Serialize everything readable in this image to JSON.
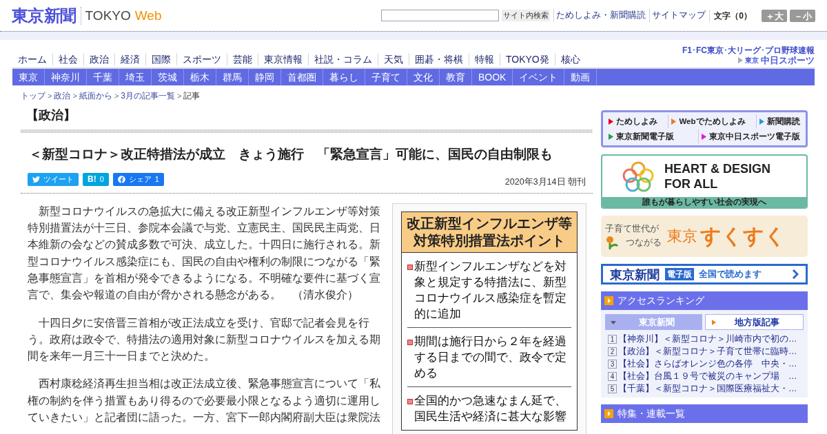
{
  "header": {
    "logo": "東京新聞",
    "brand_main": "TOKYO",
    "brand_accent": "Web",
    "search_button": "サイト内検索",
    "links": [
      "ためしよみ・新聞購読",
      "サイトマップ"
    ],
    "font_size_label": "文字（0）",
    "font_buttons": [
      "＋大",
      "－小"
    ]
  },
  "nav": {
    "items": [
      "ホーム",
      "社会",
      "政治",
      "経済",
      "国際",
      "スポーツ",
      "芸能",
      "東京情報",
      "社説・コラム",
      "天気",
      "囲碁・将棋",
      "特報",
      "TOKYO発",
      "核心"
    ],
    "sports_caption": "F1･FC東京･大リーグ･プロ野球速報",
    "sports_logo_small": "東京",
    "sports_logo": "中日スポーツ"
  },
  "regional_nav": {
    "items": [
      "東京",
      "神奈川",
      "千葉",
      "埼玉",
      "茨城",
      "栃木",
      "群馬",
      "静岡",
      "首都圏",
      "暮らし",
      "子育て",
      "文化",
      "教育",
      "BOOK",
      "イベント",
      "動画"
    ]
  },
  "breadcrumb": {
    "separator": ">",
    "items": [
      "トップ",
      "政治",
      "紙面から",
      "3月の記事一覧",
      "記事"
    ]
  },
  "article": {
    "section": "【政治】",
    "title": "＜新型コロナ＞改正特措法が成立　きょう施行　「緊急宣言」可能に、国民の自由制限も",
    "share": [
      {
        "kind": "twitter",
        "label": "ツイート"
      },
      {
        "kind": "hatena",
        "label": "B!",
        "count": "0"
      },
      {
        "kind": "facebook",
        "label": "シェア",
        "count": "1"
      }
    ],
    "date": "2020年3月14日 朝刊",
    "paragraphs": [
      "新型コロナウイルスの急拡大に備える改正新型インフルエンザ等対策特別措置法が十三日、参院本会議で与党、立憲民主、国民民主両党、日本維新の会などの賛成多数で可決、成立した。十四日に施行される。新型コロナウイルス感染症にも、国民の自由や権利の制限につながる「緊急事態宣言」を首相が発令できるようになる。不明確な要件に基づく宣言で、集会や報道の自由が脅かされる懸念がある。　（清水俊介）",
      "十四日夕に安倍晋三首相が改正法成立を受け、官邸で記者会見を行う。政府は政令で、特措法の適用対象に新型コロナウイルスを加える期間を来年一月三十一日までと決めた。",
      "西村康稔経済再生担当相は改正法成立後、緊急事態宣言について「私権の制約を伴う措置もあり得るので必要最小限となるよう適切に運用していきたい」と記者団に語った。一方、宮下一郎内閣府副大臣は衆院法"
    ],
    "infographic": {
      "title": "改正新型インフルエンザ等対策特別措置法ポイント",
      "points": [
        "新型インフルエンザなどを対象と規定する特措法に、新型コロナウイルス感染症を暫定的に追加",
        "期間は施行日から２年を経過する日までの間で、政令で定める",
        "全国的かつ急速なまん延で、国民生活や経済に甚大な影響"
      ]
    }
  },
  "sidebar": {
    "links": [
      {
        "label": "ためしよみ",
        "color": "#e60012"
      },
      {
        "label": "Webでためしよみ",
        "color": "#ee7a1a"
      },
      {
        "label": "新聞購読",
        "color": "#1e9bd7"
      },
      {
        "label": "東京新聞電子版",
        "color": "#2a9a4a"
      },
      {
        "label": "東京中日スポーツ電子版",
        "color": "#e01ad0"
      }
    ],
    "heart_banner": {
      "line_1": "HEART & DESIGN",
      "line_2": "FOR ALL",
      "caption": "誰もが暮らしやすい社会の実現へ"
    },
    "sukusuku_banner": {
      "line_1": "子育て世代が",
      "line_2": "つながる",
      "city": "東京",
      "name": "すくすく"
    },
    "digital_banner": {
      "logo": "東京新聞",
      "badge": "電子版",
      "text": "全国で読めます"
    },
    "ranking": {
      "title": "アクセスランキング",
      "tabs": [
        {
          "label": "東京新聞",
          "selected": true
        },
        {
          "label": "地方版記事",
          "selected": false
        }
      ],
      "items": [
        {
          "rank": "1",
          "text": "【神奈川】＜新型コロナ＞川崎市内で初の…"
        },
        {
          "rank": "2",
          "text": "【政治】＜新型コロナ＞子育て世帯に臨時…"
        },
        {
          "rank": "3",
          "text": "【社会】さらばオレンジ色の各停　中央・…"
        },
        {
          "rank": "4",
          "text": "【社会】台風１９号で被災のキャンプ場　…"
        },
        {
          "rank": "5",
          "text": "【千葉】＜新型コロナ＞国際医療福祉大・…"
        }
      ]
    },
    "features": {
      "title": "特集・連載一覧"
    }
  }
}
